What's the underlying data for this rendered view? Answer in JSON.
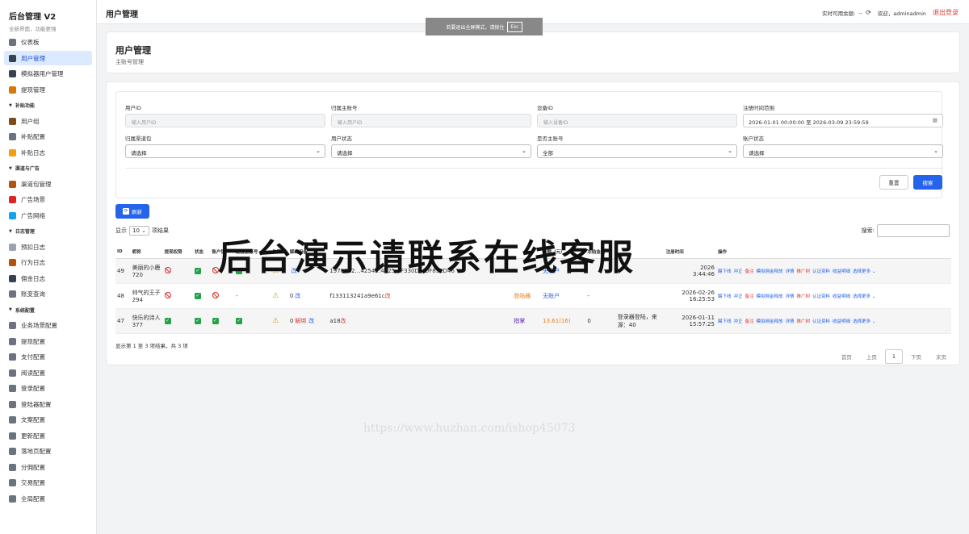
{
  "brand": {
    "title": "后台管理 V2",
    "subtitle": "全新界面，功能更强"
  },
  "sidebar": {
    "items": [
      {
        "label": "仪表板",
        "icon": "dashboard-icon",
        "color": "#6b7280",
        "type": "item"
      },
      {
        "label": "用户管理",
        "icon": "user-icon",
        "color": "#374151",
        "type": "item",
        "active": true
      },
      {
        "label": "模拟器用户管理",
        "icon": "emulator-user-icon",
        "color": "#374151",
        "type": "item"
      },
      {
        "label": "提现管理",
        "icon": "money-bag-icon",
        "color": "#d97706",
        "type": "item"
      },
      {
        "label": "补贴功能",
        "type": "section"
      },
      {
        "label": "用户组",
        "icon": "group-icon",
        "color": "#7c4a1e",
        "type": "item"
      },
      {
        "label": "补贴配置",
        "icon": "gear-icon",
        "color": "#6b7280",
        "type": "item"
      },
      {
        "label": "补贴日志",
        "icon": "gift-icon",
        "color": "#f59e0b",
        "type": "item"
      },
      {
        "label": "渠道与广告",
        "type": "section"
      },
      {
        "label": "渠道包管理",
        "icon": "package-icon",
        "color": "#b45309",
        "type": "item"
      },
      {
        "label": "广告场景",
        "icon": "target-icon",
        "color": "#dc2626",
        "type": "item"
      },
      {
        "label": "广告网络",
        "icon": "globe-icon",
        "color": "#0ea5e9",
        "type": "item"
      },
      {
        "label": "日志管理",
        "type": "section"
      },
      {
        "label": "预扣日志",
        "icon": "memo-icon",
        "color": "#9ca3af",
        "type": "item"
      },
      {
        "label": "行为日志",
        "icon": "scroll-icon",
        "color": "#b45309",
        "type": "item"
      },
      {
        "label": "佣金日志",
        "icon": "diamond-icon",
        "color": "#374151",
        "type": "item"
      },
      {
        "label": "账变查询",
        "icon": "chart-icon",
        "color": "#6b7280",
        "type": "item"
      },
      {
        "label": "系统配置",
        "type": "section"
      },
      {
        "label": "业务场景配置",
        "icon": "gear-icon",
        "color": "#6b7280",
        "type": "item"
      },
      {
        "label": "提现配置",
        "icon": "gear-icon",
        "color": "#6b7280",
        "type": "item"
      },
      {
        "label": "支付配置",
        "icon": "gear-icon",
        "color": "#6b7280",
        "type": "item"
      },
      {
        "label": "阅读配置",
        "icon": "gear-icon",
        "color": "#6b7280",
        "type": "item"
      },
      {
        "label": "登录配置",
        "icon": "gear-icon",
        "color": "#6b7280",
        "type": "item"
      },
      {
        "label": "登陆器配置",
        "icon": "gear-icon",
        "color": "#6b7280",
        "type": "item"
      },
      {
        "label": "文案配置",
        "icon": "gear-icon",
        "color": "#6b7280",
        "type": "item"
      },
      {
        "label": "更新配置",
        "icon": "gear-icon",
        "color": "#6b7280",
        "type": "item"
      },
      {
        "label": "落地页配置",
        "icon": "gear-icon",
        "color": "#6b7280",
        "type": "item"
      },
      {
        "label": "分佣配置",
        "icon": "gear-icon",
        "color": "#6b7280",
        "type": "item"
      },
      {
        "label": "交易配置",
        "icon": "gear-icon",
        "color": "#6b7280",
        "type": "item"
      },
      {
        "label": "全局配置",
        "icon": "gear-icon",
        "color": "#6b7280",
        "type": "item"
      }
    ]
  },
  "topbar": {
    "title": "用户管理",
    "balance_label": "实时可用余额:",
    "balance_value": "--",
    "welcome": "欢迎，adminadmin",
    "logout": "退出登录"
  },
  "toast": {
    "text": "若要退出全屏模式，请按住",
    "key": "Esc"
  },
  "header": {
    "title": "用户管理",
    "subtitle": "主账号管理"
  },
  "filters": {
    "user_id": {
      "label": "用户ID",
      "placeholder": "输入用户ID"
    },
    "main_account": {
      "label": "归属主账号",
      "placeholder": "输入用户ID"
    },
    "device_id": {
      "label": "设备ID",
      "placeholder": "输入设备ID"
    },
    "reg_time": {
      "label": "注册时间范围",
      "value": "2026-01-01 00:00:00 至 2026-03-09 23:59:59"
    },
    "channel": {
      "label": "归属渠道包",
      "value": "请选择"
    },
    "user_status": {
      "label": "用户状态",
      "value": "请选择"
    },
    "is_main": {
      "label": "是否主账号",
      "value": "全部"
    },
    "account_status": {
      "label": "账户状态",
      "value": "请选择"
    },
    "reset": "重置",
    "search": "搜索"
  },
  "toolbar": {
    "refresh": "刷新",
    "show": "显示",
    "page_size": "10",
    "entries": "项结果",
    "search_label": "搜索:"
  },
  "table": {
    "headers": [
      "ID",
      "昵称",
      "提现权限",
      "状态",
      "账户锁",
      "是否主账号",
      "告警",
      "解绑设备",
      "",
      "",
      "余额（元）",
      "冻结金额",
      "",
      "注册时间",
      "操作"
    ],
    "rows": [
      {
        "id": "49",
        "nickname": "美丽的小鹿720",
        "perm": "ban",
        "status": "check",
        "lock": "ban",
        "main": "check",
        "warn": "⚠",
        "unbind_count": "",
        "unbind_op": "改",
        "device": "1970E02…4254…4525…F330D…DF89ED46",
        "device_tag": "",
        "type": "",
        "balance": "无账户",
        "frozen": "",
        "note": "",
        "reg_date": "2026",
        "reg_time": "3:44:46",
        "ops": [
          "踢下线",
          "冲正",
          "备注",
          "模拟佣金释放",
          "详情",
          "推广树",
          "认证资料",
          "收益明细",
          "选择更多 ⌄"
        ]
      },
      {
        "id": "48",
        "nickname": "帅气的王子294",
        "perm": "ban",
        "status": "check",
        "lock": "ban",
        "main": "-",
        "warn": "⚠",
        "unbind_count": "0",
        "unbind_op": "改",
        "device": "f133113241a9e61c",
        "device_tag": "改",
        "type": "登陆器",
        "balance": "无账户",
        "frozen": "-",
        "note": "",
        "reg_date": "2026-02-26",
        "reg_time": "16:25:53",
        "ops": [
          "踢下线",
          "冲正",
          "备注",
          "模拟佣金释放",
          "详情",
          "推广树",
          "认证资料",
          "收益明细",
          "选择更多 ⌄"
        ]
      },
      {
        "id": "47",
        "nickname": "快乐的诗人377",
        "perm": "check",
        "status": "check",
        "lock": "check",
        "main": "check",
        "warn": "⚠",
        "unbind_count": "0",
        "unbind_op": "解绑",
        "unbind_op2": "改",
        "device": "a18",
        "device_tag": "改",
        "type": "指掌",
        "balance": "13.61(16)",
        "frozen": "0",
        "note": "登录器登陆，来源：40",
        "reg_date": "2026-01-11",
        "reg_time": "15:57:25",
        "ops": [
          "踢下线",
          "冲正",
          "备注",
          "模拟佣金释放",
          "详情",
          "推广树",
          "认证资料",
          "收益明细",
          "选择更多 ⌄"
        ]
      }
    ]
  },
  "footer": {
    "summary": "显示第 1 至 3 项结果，共 3 项"
  },
  "pager": {
    "first": "首页",
    "prev": "上页",
    "current": "1",
    "next": "下页",
    "last": "末页"
  },
  "watermark": {
    "main": "后台演示请联系在线客服",
    "url": "https://www.huzhan.com/ishop45073"
  }
}
